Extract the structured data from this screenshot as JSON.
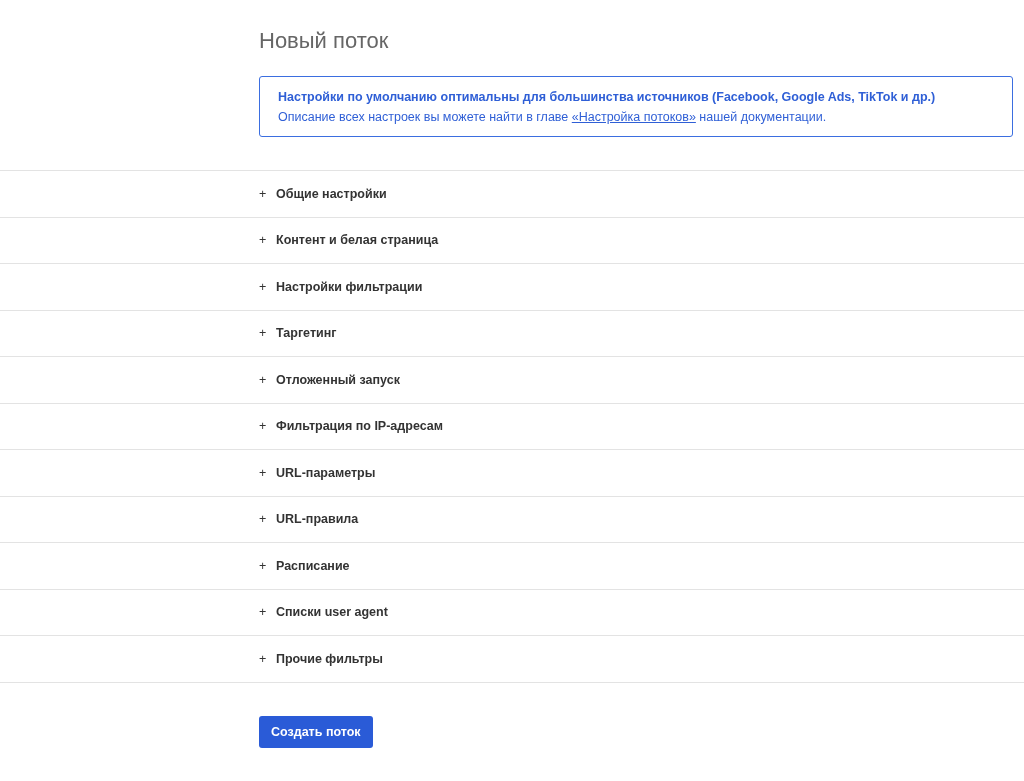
{
  "title": "Новый поток",
  "notice": {
    "heading": "Настройки по умолчанию оптимальны для большинства источников (Facebook, Google Ads, TikTok и др.)",
    "text_before": "Описание всех настроек вы можете найти в главе",
    "link": "«Настройка потоков»",
    "text_after": "нашей документации."
  },
  "sections": [
    {
      "marker": "+",
      "label": "Общие настройки"
    },
    {
      "marker": "+",
      "label": "Контент и белая страница"
    },
    {
      "marker": "+",
      "label": "Настройки фильтрации"
    },
    {
      "marker": "+",
      "label": "Таргетинг"
    },
    {
      "marker": "+",
      "label": "Отложенный запуск"
    },
    {
      "marker": "+",
      "label": "Фильтрация по IP-адресам"
    },
    {
      "marker": "+",
      "label": "URL-параметры"
    },
    {
      "marker": "+",
      "label": "URL-правила"
    },
    {
      "marker": "+",
      "label": "Расписание"
    },
    {
      "marker": "+",
      "label": "Списки user agent"
    },
    {
      "marker": "+",
      "label": "Прочие фильтры"
    }
  ],
  "submit_button": "Создать поток"
}
